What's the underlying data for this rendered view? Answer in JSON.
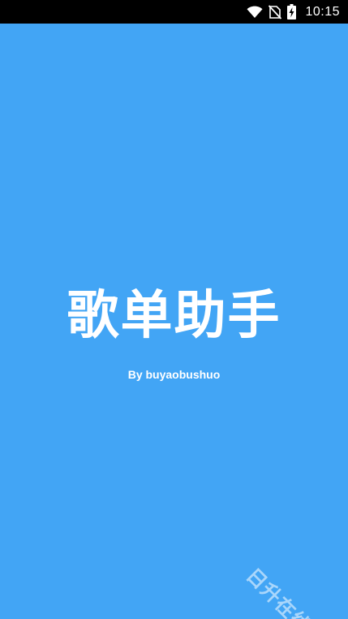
{
  "status_bar": {
    "time": "10:15",
    "icons": [
      "wifi-icon",
      "no-sim-icon",
      "battery-charging-icon"
    ]
  },
  "splash": {
    "app_name": "歌单助手",
    "author": "By buyaobushuo"
  },
  "watermark": {
    "text": "日升在线"
  },
  "colors": {
    "background": "#42a5f5",
    "status_bar": "#000000",
    "text": "#ffffff"
  }
}
